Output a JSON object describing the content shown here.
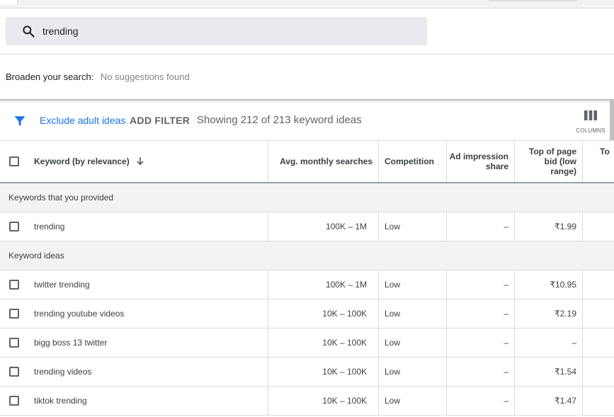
{
  "search": {
    "query": "trending"
  },
  "broaden": {
    "label": "Broaden your search:",
    "value": "No suggestions found"
  },
  "filter_bar": {
    "exclude_label": "Exclude adult ideas",
    "add_filter_label": "ADD FILTER",
    "showing_text": "Showing 212 of 213 keyword ideas",
    "columns_label": "COLUMNS"
  },
  "table": {
    "headers": {
      "keyword": "Keyword (by relevance)",
      "avg_searches": "Avg. monthly searches",
      "competition": "Competition",
      "ad_impression_share": [
        "Ad impression",
        "share"
      ],
      "top_bid_low": [
        "Top of page",
        "bid (low",
        "range)"
      ],
      "top_bid_high": "To"
    },
    "groups": [
      {
        "title": "Keywords that you provided",
        "rows": [
          {
            "keyword": "trending",
            "searches": "100K – 1M",
            "competition": "Low",
            "impression": "–",
            "bid_low": "₹1.99"
          }
        ]
      },
      {
        "title": "Keyword ideas",
        "rows": [
          {
            "keyword": "twitter trending",
            "searches": "100K – 1M",
            "competition": "Low",
            "impression": "–",
            "bid_low": "₹10.95"
          },
          {
            "keyword": "trending youtube videos",
            "searches": "10K – 100K",
            "competition": "Low",
            "impression": "–",
            "bid_low": "₹2.19"
          },
          {
            "keyword": "bigg boss 13 twitter",
            "searches": "10K – 100K",
            "competition": "Low",
            "impression": "–",
            "bid_low": "–"
          },
          {
            "keyword": "trending videos",
            "searches": "10K – 100K",
            "competition": "Low",
            "impression": "–",
            "bid_low": "₹1.54"
          },
          {
            "keyword": "tiktok trending",
            "searches": "10K – 100K",
            "competition": "Low",
            "impression": "–",
            "bid_low": "₹1.47"
          }
        ]
      }
    ]
  },
  "colors": {
    "accent": "#1a73e8",
    "muted": "#5f6368",
    "group_bg": "#f1f3f4"
  }
}
